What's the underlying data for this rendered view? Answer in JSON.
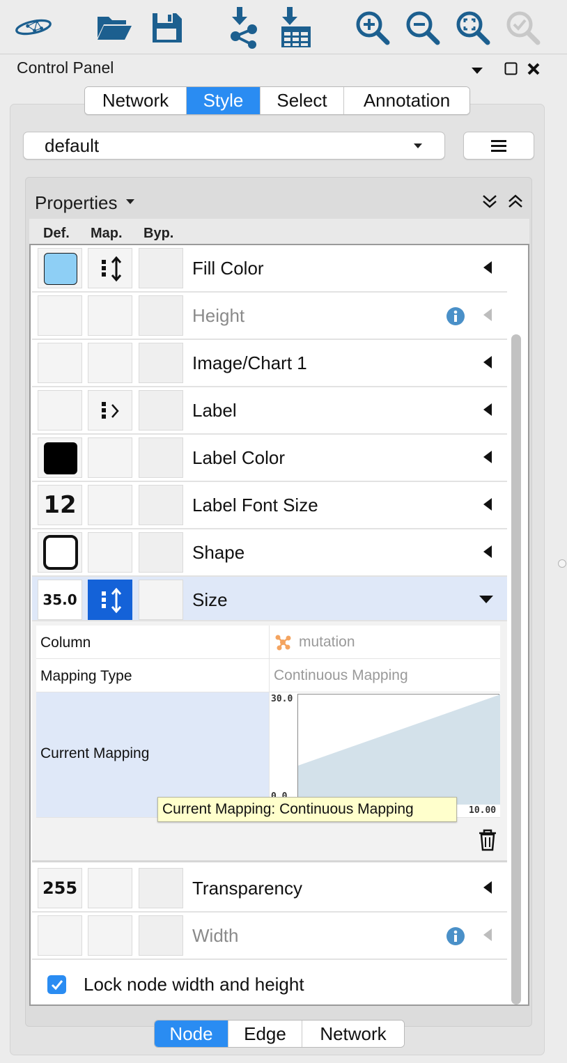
{
  "toolbar": {
    "buttons": [
      {
        "name": "cytoscape-logo-icon"
      },
      {
        "name": "open-folder-icon"
      },
      {
        "name": "save-icon"
      },
      {
        "name": "import-network-icon"
      },
      {
        "name": "import-table-icon"
      },
      {
        "name": "zoom-in-icon"
      },
      {
        "name": "zoom-out-icon"
      },
      {
        "name": "zoom-fit-icon"
      },
      {
        "name": "zoom-selected-icon"
      }
    ]
  },
  "panel": {
    "title": "Control Panel"
  },
  "top_tabs": [
    {
      "label": "Network",
      "active": false
    },
    {
      "label": "Style",
      "active": true
    },
    {
      "label": "Select",
      "active": false
    },
    {
      "label": "Annotation",
      "active": false
    }
  ],
  "style_selector": {
    "value": "default"
  },
  "properties": {
    "title": "Properties",
    "columns": {
      "def": "Def.",
      "map": "Map.",
      "byp": "Byp."
    },
    "rows": [
      {
        "label": "Fill Color",
        "def": "swatch",
        "def_color": "#8ecff5",
        "mapping": "continuous",
        "state": "normal"
      },
      {
        "label": "Height",
        "def": "",
        "mapping": "",
        "state": "disabled"
      },
      {
        "label": "Image/Chart 1",
        "def": "",
        "mapping": "",
        "state": "normal"
      },
      {
        "label": "Label",
        "def": "",
        "mapping": "passthrough",
        "state": "normal"
      },
      {
        "label": "Label Color",
        "def": "swatch",
        "def_color": "#000000",
        "mapping": "",
        "state": "normal"
      },
      {
        "label": "Label Font Size",
        "def": "12",
        "mapping": "",
        "state": "normal"
      },
      {
        "label": "Shape",
        "def": "shape",
        "mapping": "",
        "state": "normal"
      },
      {
        "label": "Size",
        "def": "35.0",
        "mapping": "continuous",
        "state": "selected"
      },
      {
        "label": "Transparency",
        "def": "255",
        "mapping": "",
        "state": "normal"
      },
      {
        "label": "Width",
        "def": "",
        "mapping": "",
        "state": "disabled"
      }
    ],
    "mapping_detail": {
      "column_key": "Column",
      "column_value": "mutation",
      "type_key": "Mapping Type",
      "type_value": "Continuous Mapping",
      "current_key": "Current Mapping",
      "y_max": "30.0",
      "y_min": "0.0",
      "x_max": "10.00",
      "tooltip": "Current Mapping: Continuous Mapping"
    },
    "lock_label": "Lock node width and height",
    "lock_checked": true
  },
  "bottom_tabs": [
    {
      "label": "Node",
      "active": true
    },
    {
      "label": "Edge",
      "active": false
    },
    {
      "label": "Network",
      "active": false
    }
  ],
  "colors": {
    "accent": "#2a8cf2",
    "icon_blue": "#1c5f8f",
    "selected_row": "#dfe8f8",
    "mapping_chip": "#1462d8"
  }
}
